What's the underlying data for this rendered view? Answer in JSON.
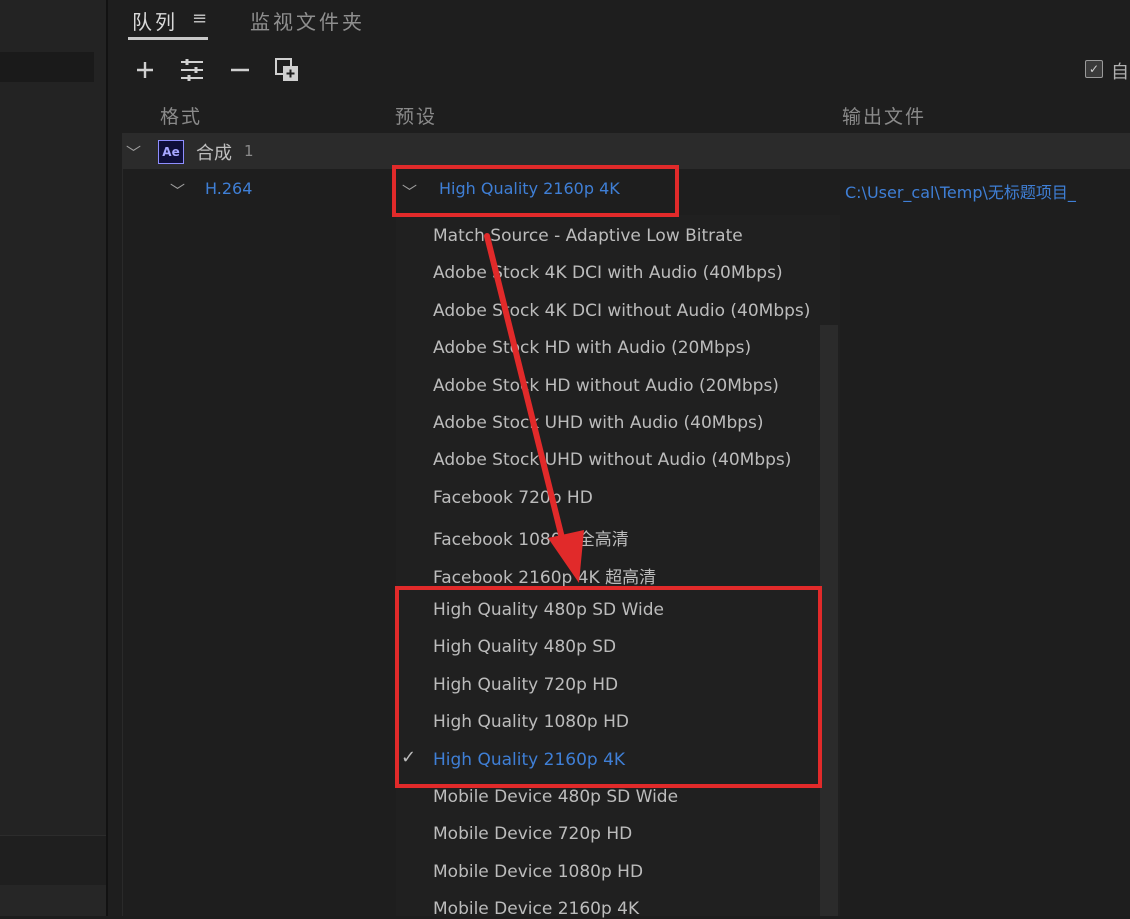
{
  "tabs": {
    "queue": "队列",
    "watch": "监视文件夹"
  },
  "toolbar": {
    "auto_label": "自"
  },
  "columns": {
    "format": "格式",
    "preset": "预设",
    "output": "输出文件"
  },
  "item": {
    "comp_icon": "Ae",
    "comp_name": "合成",
    "comp_index": "1",
    "format": "H.264",
    "preset": "High Quality 2160p 4K",
    "output": "C:\\User_cal\\Temp\\无标题项目_"
  },
  "preset_options": [
    "Match Source - Adaptive Low Bitrate",
    "Adobe Stock 4K DCI with Audio (40Mbps)",
    "Adobe Stock 4K DCI without Audio (40Mbps)",
    "Adobe Stock HD with Audio (20Mbps)",
    "Adobe Stock HD without Audio (20Mbps)",
    "Adobe Stock UHD with Audio (40Mbps)",
    "Adobe Stock UHD without Audio (40Mbps)",
    "Facebook 720p HD",
    "Facebook 1080p 全高清",
    "Facebook 2160p 4K 超高清",
    "High Quality 480p SD Wide",
    "High Quality 480p SD",
    "High Quality 720p HD",
    "High Quality 1080p HD",
    "High Quality 2160p 4K",
    "Mobile Device 480p SD Wide",
    "Mobile Device 720p HD",
    "Mobile Device 1080p HD",
    "Mobile Device 2160p 4K"
  ],
  "selected_index": 14,
  "icons": {
    "add": "plus-icon",
    "settings": "sliders-icon",
    "remove": "minus-icon",
    "duplicate": "duplicate-icon",
    "menu": "hamburger-icon",
    "check": "checkmark-icon"
  },
  "colors": {
    "accent": "#3f7fd6",
    "highlight": "#e12a2a"
  }
}
